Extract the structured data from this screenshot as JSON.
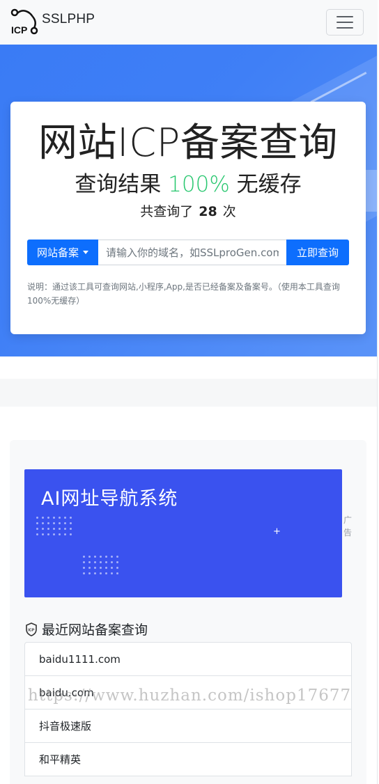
{
  "navbar": {
    "logo_text": "ICP",
    "brand_name": "SSLPHP",
    "menu_icon": "hamburger-menu-icon"
  },
  "hero": {
    "title": "网站ICP备案查询",
    "subtitle_prefix": "查询结果 ",
    "subtitle_highlight": "100%",
    "subtitle_suffix": " 无缓存",
    "count_prefix": "共查询了",
    "count_value": "28",
    "count_suffix": "次",
    "highlight_color": "#28c76f",
    "accent_color": "#0d6efd"
  },
  "search": {
    "type_select_label": "网站备案",
    "input_placeholder": "请输入你的域名，如SSLproGen.com",
    "input_value": "",
    "submit_label": "立即查询",
    "note": "说明：通过该工具可查询网站,小程序,App,是否已经备案及备案号。（使用本工具查询100%无缓存）"
  },
  "ad": {
    "banner_title": "AI网址导航系统",
    "label": "广告",
    "banner_color": "#3a52ef"
  },
  "recent": {
    "icon": "icp-shield-icon",
    "title": "最近网站备案查询",
    "items": [
      {
        "label": "baidu1111.com"
      },
      {
        "label": "baidu.com"
      },
      {
        "label": "抖音极速版"
      },
      {
        "label": "和平精英"
      }
    ]
  },
  "watermark": "https://www.huzhan.com/ishop17677"
}
